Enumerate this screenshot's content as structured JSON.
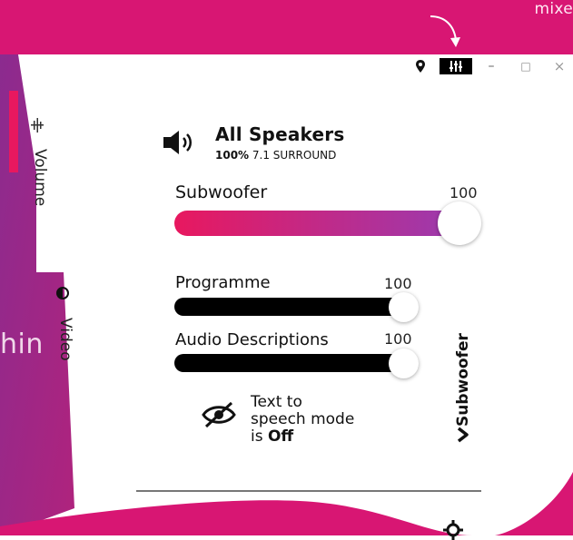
{
  "banner": {
    "text": "mixe"
  },
  "titlebar": {
    "icons": [
      "location-pin-icon",
      "mixer-icon",
      "minimize-icon",
      "restore-icon",
      "close-icon"
    ],
    "minimize": "–",
    "restore": "□",
    "close": "×"
  },
  "sidebar": {
    "tabs": [
      {
        "label": "Volume",
        "icon": "equalizer-icon"
      },
      {
        "label": "Video",
        "icon": "contrast-icon"
      }
    ],
    "bg_partial_text": "hin"
  },
  "speakers": {
    "title": "All Speakers",
    "level": "100%",
    "mode": "7.1 SURROUND",
    "icon": "speaker-icon"
  },
  "sliders": [
    {
      "label": "Subwoofer",
      "value": "100",
      "level": 1.0
    },
    {
      "label": "Programme",
      "value": "100",
      "level": 1.0
    },
    {
      "label": "Audio Descriptions",
      "value": "100",
      "level": 1.0
    }
  ],
  "tts": {
    "line1": "Text to",
    "line2": "speech mode",
    "line3_prefix": "is ",
    "line3_state": "Off",
    "icon": "eye-off-icon"
  },
  "side_panel": {
    "label": "Subwoofer",
    "icon": "chevron-right-icon"
  },
  "settings": {
    "icon": "gear-icon"
  },
  "colors": {
    "brand_pink": "#d81673",
    "gradient_start": "#e8185f",
    "gradient_end": "#9a3bb0",
    "purple_sidebar": "#7a2a86"
  }
}
